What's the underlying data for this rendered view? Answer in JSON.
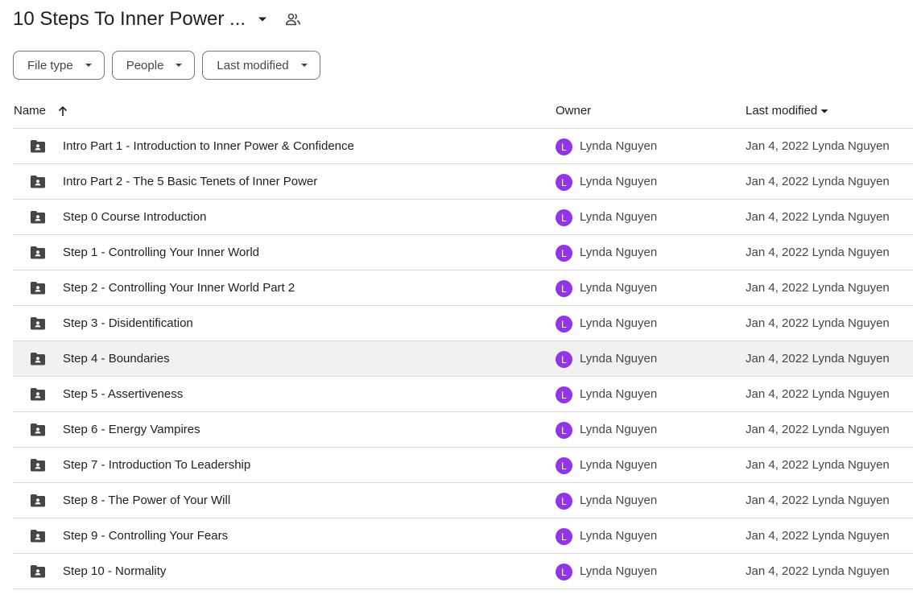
{
  "header": {
    "title": "10 Steps To Inner Power ...",
    "dropdown_icon": "caret-down-icon",
    "shared_icon": "people-icon"
  },
  "filters": [
    {
      "label": "File type"
    },
    {
      "label": "People"
    },
    {
      "label": "Last modified"
    }
  ],
  "table": {
    "columns": {
      "name": "Name",
      "owner": "Owner",
      "last_modified": "Last modified"
    },
    "avatar_color": "#9334e6",
    "rows": [
      {
        "name": "Intro Part 1 - Introduction to Inner Power & Confidence",
        "avatar": "L",
        "owner": "Lynda Nguyen",
        "modified": "Jan 4, 2022 Lynda Nguyen"
      },
      {
        "name": "Intro Part 2 -  The 5 Basic Tenets of Inner Power",
        "avatar": "L",
        "owner": "Lynda Nguyen",
        "modified": "Jan 4, 2022 Lynda Nguyen"
      },
      {
        "name": "Step 0 Course Introduction",
        "avatar": "L",
        "owner": "Lynda Nguyen",
        "modified": "Jan 4, 2022 Lynda Nguyen"
      },
      {
        "name": "Step 1 - Controlling Your Inner World",
        "avatar": "L",
        "owner": "Lynda Nguyen",
        "modified": "Jan 4, 2022 Lynda Nguyen"
      },
      {
        "name": "Step 2 - Controlling Your Inner World Part 2",
        "avatar": "L",
        "owner": "Lynda Nguyen",
        "modified": "Jan 4, 2022 Lynda Nguyen"
      },
      {
        "name": "Step 3 - Disidentification",
        "avatar": "L",
        "owner": "Lynda Nguyen",
        "modified": "Jan 4, 2022 Lynda Nguyen"
      },
      {
        "name": "Step 4 - Boundaries",
        "avatar": "L",
        "owner": "Lynda Nguyen",
        "modified": "Jan 4, 2022 Lynda Nguyen"
      },
      {
        "name": "Step 5 - Assertiveness",
        "avatar": "L",
        "owner": "Lynda Nguyen",
        "modified": "Jan 4, 2022 Lynda Nguyen"
      },
      {
        "name": "Step 6 - Energy Vampires",
        "avatar": "L",
        "owner": "Lynda Nguyen",
        "modified": "Jan 4, 2022 Lynda Nguyen"
      },
      {
        "name": "Step 7 - Introduction To Leadership",
        "avatar": "L",
        "owner": "Lynda Nguyen",
        "modified": "Jan 4, 2022 Lynda Nguyen"
      },
      {
        "name": "Step 8 - The Power of Your Will",
        "avatar": "L",
        "owner": "Lynda Nguyen",
        "modified": "Jan 4, 2022 Lynda Nguyen"
      },
      {
        "name": "Step 9 - Controlling Your Fears",
        "avatar": "L",
        "owner": "Lynda Nguyen",
        "modified": "Jan 4, 2022 Lynda Nguyen"
      },
      {
        "name": "Step 10 - Normality",
        "avatar": "L",
        "owner": "Lynda Nguyen",
        "modified": "Jan 4, 2022 Lynda Nguyen"
      }
    ]
  }
}
